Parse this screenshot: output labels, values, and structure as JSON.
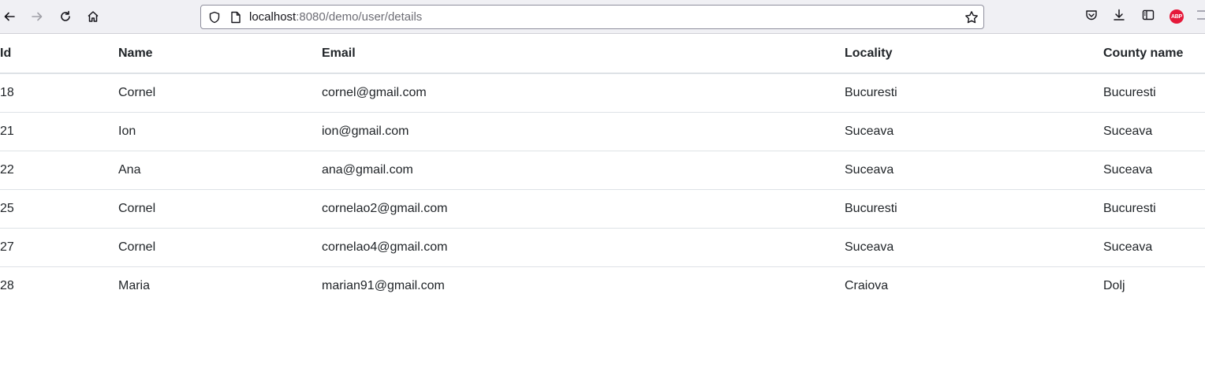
{
  "browser": {
    "url_host": "localhost",
    "url_path": ":8080/demo/user/details",
    "icons": {
      "back": "arrow-left-icon",
      "forward": "arrow-right-icon",
      "reload": "reload-icon",
      "home": "home-icon",
      "shield": "shield-icon",
      "page": "page-icon",
      "bookmark": "star-icon",
      "pocket": "pocket-icon",
      "downloads": "download-icon",
      "sidebar": "sidebar-icon",
      "adblock": "adblock-icon"
    },
    "adblock_label": "ABP"
  },
  "table": {
    "headers": {
      "id": "Id",
      "name": "Name",
      "email": "Email",
      "locality": "Locality",
      "county": "County name"
    },
    "rows": [
      {
        "id": "18",
        "name": "Cornel",
        "email": "cornel@gmail.com",
        "locality": "Bucuresti",
        "county": "Bucuresti"
      },
      {
        "id": "21",
        "name": "Ion",
        "email": "ion@gmail.com",
        "locality": "Suceava",
        "county": "Suceava"
      },
      {
        "id": "22",
        "name": "Ana",
        "email": "ana@gmail.com",
        "locality": "Suceava",
        "county": "Suceava"
      },
      {
        "id": "25",
        "name": "Cornel",
        "email": "cornelao2@gmail.com",
        "locality": "Bucuresti",
        "county": "Bucuresti"
      },
      {
        "id": "27",
        "name": "Cornel",
        "email": "cornelao4@gmail.com",
        "locality": "Suceava",
        "county": "Suceava"
      },
      {
        "id": "28",
        "name": "Maria",
        "email": "marian91@gmail.com",
        "locality": "Craiova",
        "county": "Dolj"
      }
    ]
  }
}
